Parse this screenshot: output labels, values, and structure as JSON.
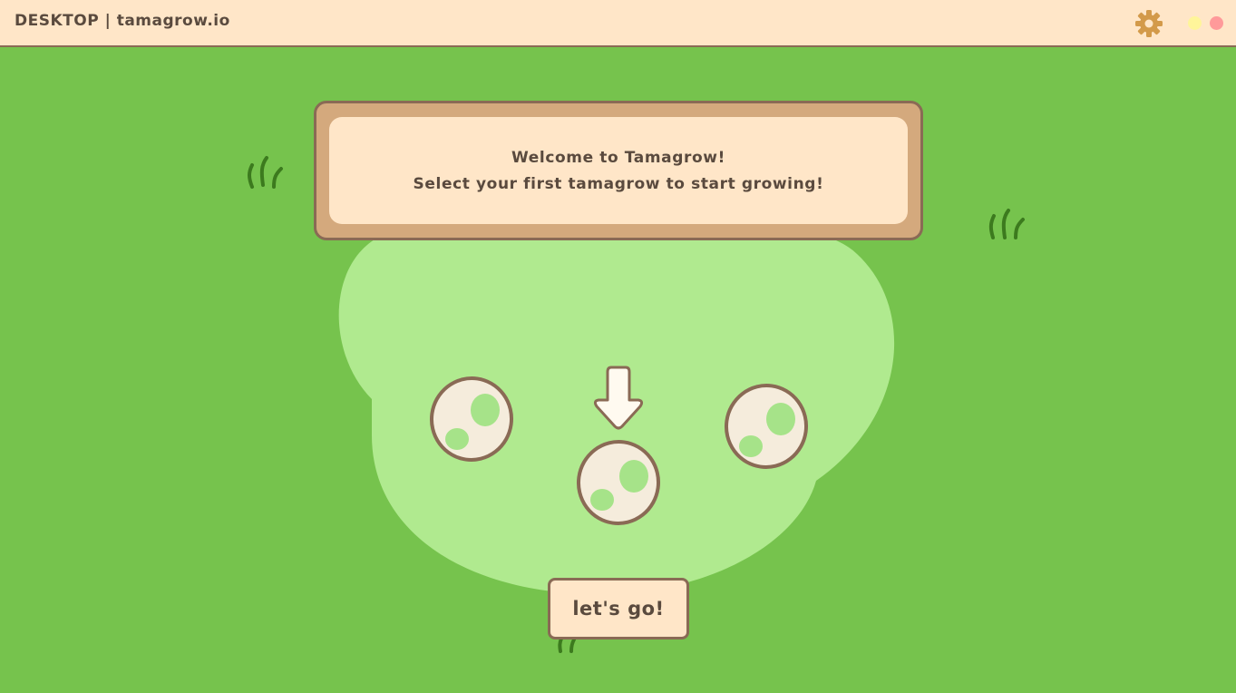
{
  "window": {
    "title": "DESKTOP | tamagrow.io",
    "settings_icon": "gear-icon",
    "minimize_icon": "minimize-dot",
    "close_icon": "close-dot"
  },
  "banner": {
    "line1": "Welcome to Tamagrow!",
    "line2": "Select your first tamagrow to start growing!"
  },
  "eggs": [
    {
      "name": "left-egg",
      "selected": false
    },
    {
      "name": "center-egg",
      "selected": true
    },
    {
      "name": "right-egg",
      "selected": false
    }
  ],
  "cta": {
    "label": "let's go!"
  },
  "colors": {
    "grass": "#76c34d",
    "clearing": "#b0ea8f",
    "cream": "#ffe6c8",
    "frame": "#d4a97d",
    "outline": "#8a6a55",
    "text": "#5a4a3e",
    "gear": "#d39a4a",
    "minimize": "#fff59a",
    "close": "#ff9a9a",
    "egg_shell": "#f5ecdc",
    "egg_spot": "#a6e389",
    "tuft": "#3c7a1e"
  }
}
